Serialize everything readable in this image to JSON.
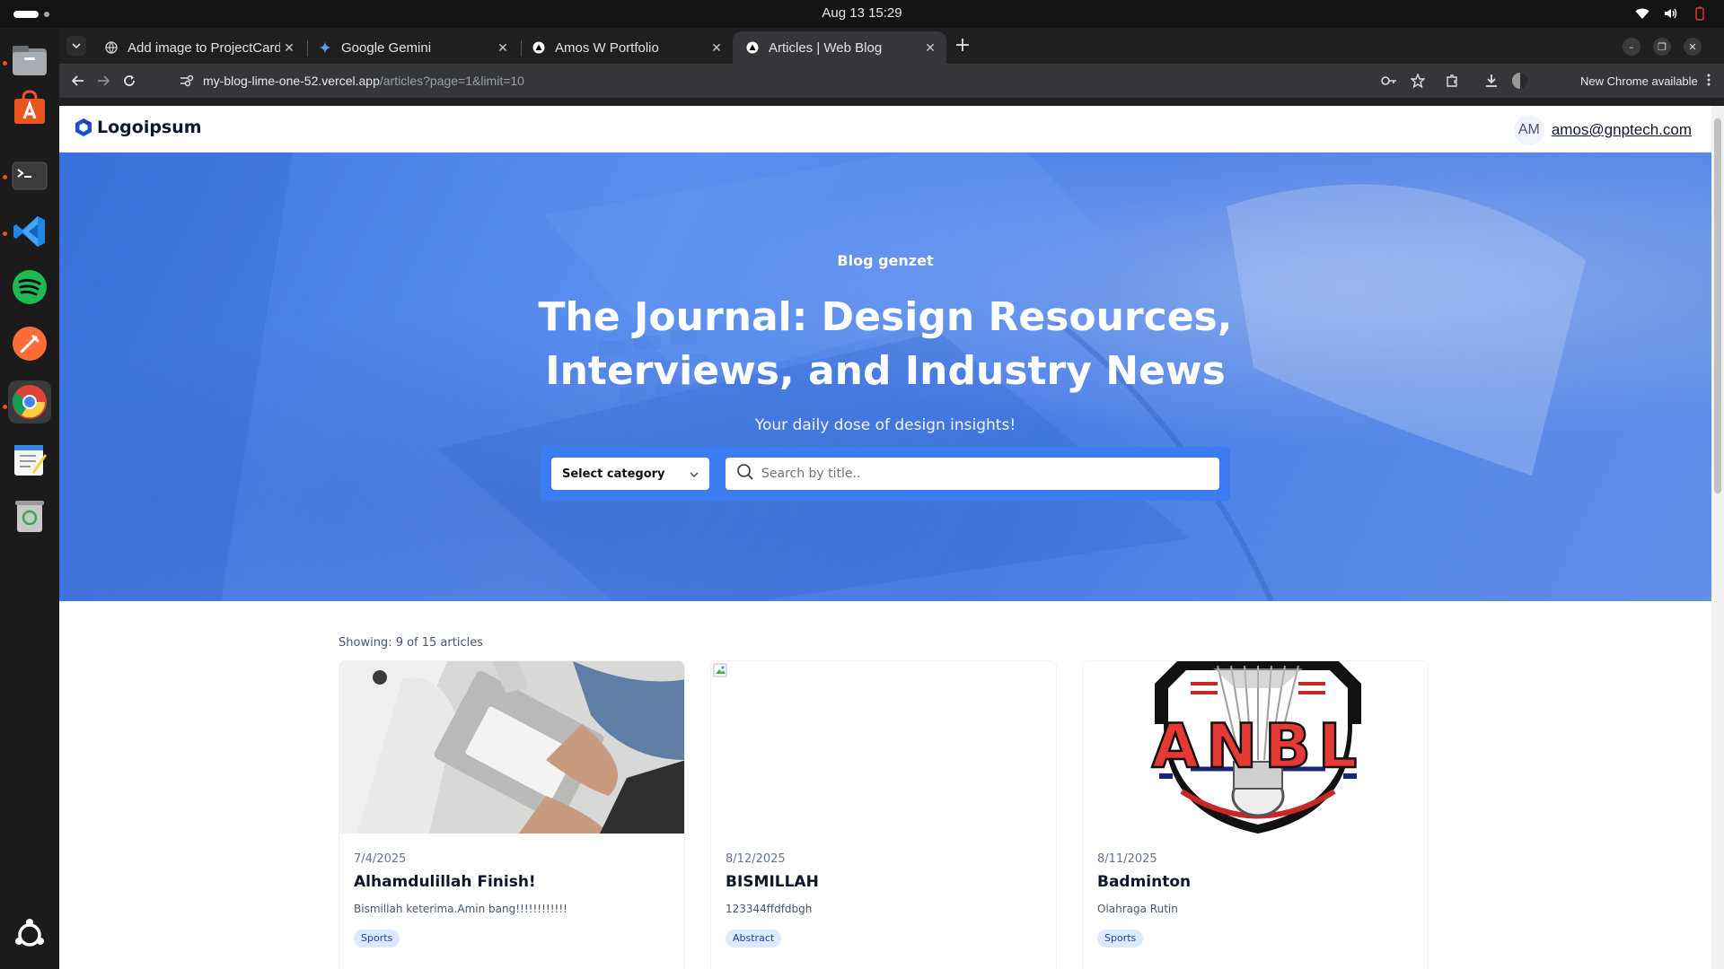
{
  "system": {
    "clock": "Aug 13  15:29"
  },
  "dock": {
    "apps": [
      {
        "name": "files-icon"
      },
      {
        "name": "app-center-icon"
      },
      {
        "name": "terminal-icon"
      },
      {
        "name": "vscode-icon"
      },
      {
        "name": "spotify-icon"
      },
      {
        "name": "postman-icon"
      },
      {
        "name": "chrome-icon"
      },
      {
        "name": "text-editor-icon"
      },
      {
        "name": "trash-icon"
      }
    ]
  },
  "browser": {
    "tabs": [
      {
        "title": "Add image to ProjectCard"
      },
      {
        "title": "Google Gemini"
      },
      {
        "title": "Amos W Portfolio"
      },
      {
        "title": "Articles | Web Blog"
      }
    ],
    "url_host": "my-blog-lime-one-52.vercel.app",
    "url_path": "/articles?page=1&limit=10",
    "update_label": "New Chrome available"
  },
  "site": {
    "logo_text": "Logoipsum",
    "user_initials": "AM",
    "user_email": "amos@gnptech.com"
  },
  "hero": {
    "kicker": "Blog genzet",
    "title": "The Journal: Design Resources, Interviews, and Industry News",
    "subtitle": "Your daily dose of design insights!",
    "select_label": "Select category",
    "search_placeholder": "Search by title.."
  },
  "articles": {
    "count_label": "Showing: 9 of 15 articles",
    "items": [
      {
        "date": "7/4/2025",
        "title": "Alhamdulillah Finish!",
        "excerpt": "Bismillah keterima.Amin bang!!!!!!!!!!!!",
        "tag": "Sports"
      },
      {
        "date": "8/12/2025",
        "title": "BISMILLAH",
        "excerpt": "123344ffdfdbgh",
        "tag": "Abstract"
      },
      {
        "date": "8/11/2025",
        "title": "Badminton",
        "excerpt": "Olahraga Rutin",
        "tag": "Sports",
        "logo_text": "ANBL"
      }
    ]
  }
}
